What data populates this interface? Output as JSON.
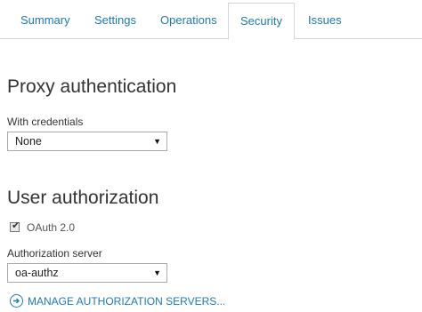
{
  "tabs": [
    {
      "label": "Summary"
    },
    {
      "label": "Settings"
    },
    {
      "label": "Operations"
    },
    {
      "label": "Security",
      "selected": true
    },
    {
      "label": "Issues"
    }
  ],
  "proxy_auth": {
    "title": "Proxy authentication",
    "credentials_label": "With credentials",
    "credentials_value": "None"
  },
  "user_auth": {
    "title": "User authorization",
    "oauth_label": "OAuth 2.0",
    "oauth_checked": true,
    "server_label": "Authorization server",
    "server_value": "oa-authz"
  },
  "manage_link": {
    "label": "MANAGE AUTHORIZATION SERVERS...",
    "icon": "arrow-circle-icon"
  },
  "colors": {
    "accent": "#1c7ab2",
    "text": "#333333",
    "border": "#d6d6d6"
  }
}
